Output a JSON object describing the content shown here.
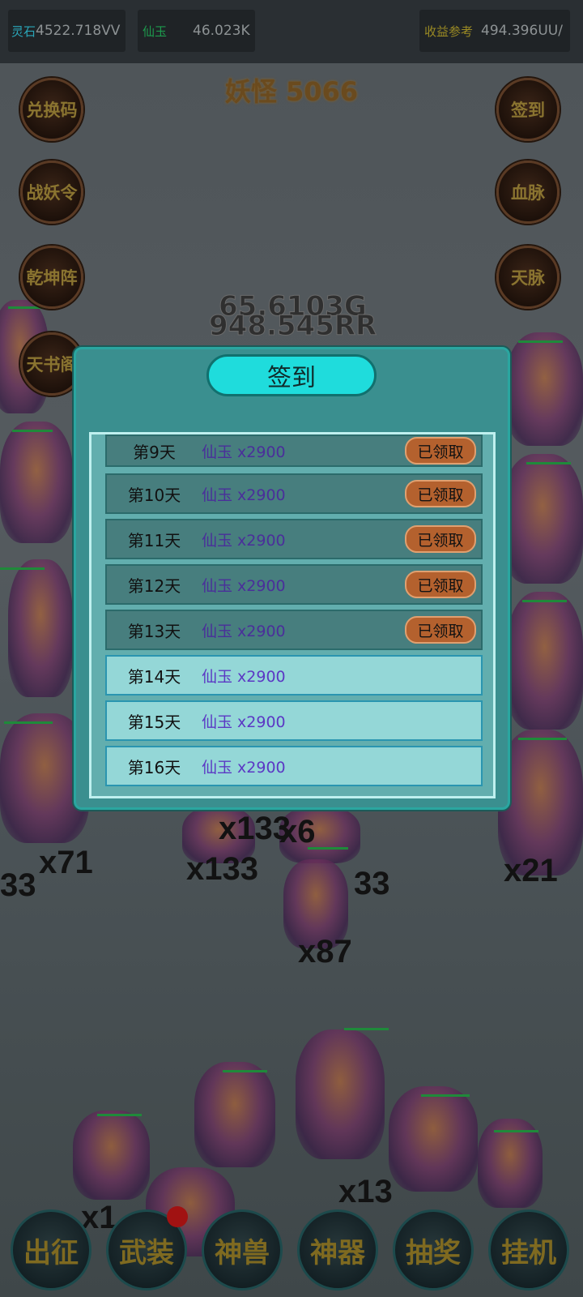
{
  "topbar": {
    "lingshi": {
      "label": "灵石",
      "value": "4522.718VV"
    },
    "xianyu": {
      "label": "仙玉",
      "value": "46.023K"
    },
    "shouyi": {
      "label": "收益参考",
      "value": "494.396UU/"
    }
  },
  "monster_title": "妖怪 5066",
  "left_buttons": [
    "兑换码",
    "战妖令",
    "乾坤阵",
    "天书阁"
  ],
  "right_buttons": [
    "签到",
    "血脉",
    "天脉"
  ],
  "battle": {
    "damage_numbers": [
      "65.6103G",
      "948.545RR"
    ],
    "counts": [
      "x71",
      "x133",
      "x133",
      "33",
      "x87",
      "x6",
      "33",
      "x13",
      "x1",
      "x21"
    ]
  },
  "dialog": {
    "title": "签到",
    "rows": [
      {
        "day": "第9天",
        "reward": "仙玉 x2900",
        "status": "已领取"
      },
      {
        "day": "第10天",
        "reward": "仙玉 x2900",
        "status": "已领取"
      },
      {
        "day": "第11天",
        "reward": "仙玉 x2900",
        "status": "已领取"
      },
      {
        "day": "第12天",
        "reward": "仙玉 x2900",
        "status": "已领取"
      },
      {
        "day": "第13天",
        "reward": "仙玉 x2900",
        "status": "已领取"
      },
      {
        "day": "第14天",
        "reward": "仙玉 x2900",
        "status": ""
      },
      {
        "day": "第15天",
        "reward": "仙玉 x2900",
        "status": ""
      },
      {
        "day": "第16天",
        "reward": "仙玉 x2900",
        "status": ""
      }
    ]
  },
  "bottom_nav": [
    "出征",
    "武装",
    "神兽",
    "神器",
    "抽奖",
    "挂机"
  ],
  "colors": {
    "dialog_bg": "#3a8f8f",
    "title_pill": "#1fdcdc",
    "claimed_button": "#b4612e",
    "reward_text": "#5b38c4"
  }
}
